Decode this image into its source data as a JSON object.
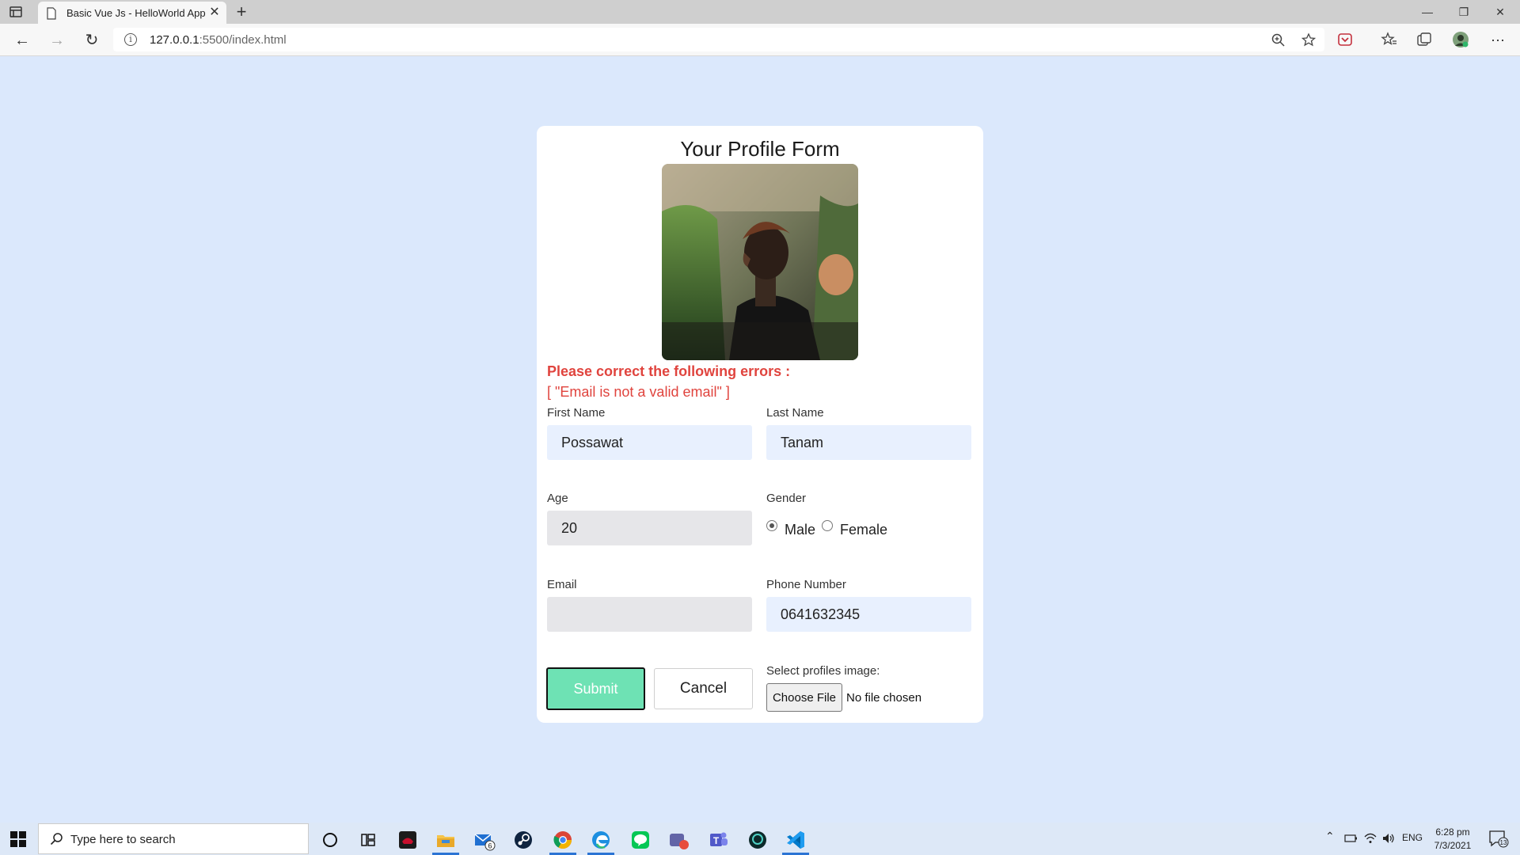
{
  "browser": {
    "tab_title": "Basic Vue Js - HelloWorld App",
    "url_host": "127.0.0.1",
    "url_path": ":5500/index.html"
  },
  "form": {
    "title": "Your Profile Form",
    "error_heading": "Please correct the following errors :",
    "error_list": "[ \"Email is not a valid email\" ]",
    "first_name_label": "First Name",
    "first_name_value": "Possawat",
    "last_name_label": "Last Name",
    "last_name_value": "Tanam",
    "age_label": "Age",
    "age_value": "20",
    "gender_label": "Gender",
    "gender_options": [
      "Male",
      "Female"
    ],
    "gender_selected": "Male",
    "email_label": "Email",
    "email_value": "",
    "phone_label": "Phone Number",
    "phone_value": "0641632345",
    "submit_label": "Submit",
    "cancel_label": "Cancel",
    "image_label": "Select profiles image:",
    "choose_file_label": "Choose File",
    "file_status": "No file chosen"
  },
  "taskbar": {
    "search_placeholder": "Type here to search",
    "mail_badge": "6",
    "language": "ENG",
    "time": "6:28 pm",
    "date": "7/3/2021",
    "notification_count": "13"
  },
  "colors": {
    "page_bg": "#dbe8fc",
    "error": "#e0443e",
    "submit_bg": "#6ee2b4",
    "input_blue": "#e8f0fe",
    "input_grey": "#e6e6e9"
  }
}
